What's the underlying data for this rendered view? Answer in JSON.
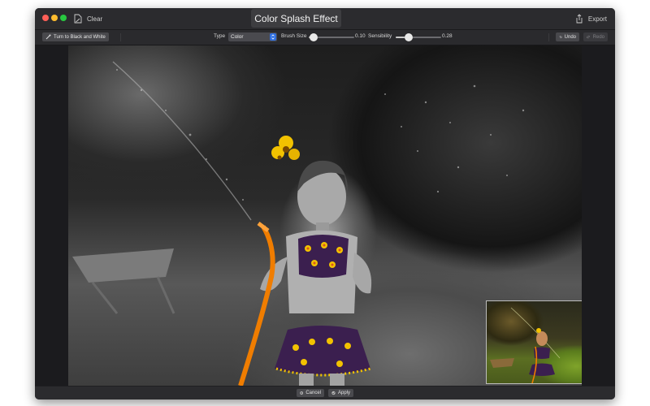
{
  "window": {
    "clear_label": "Clear",
    "title": "Color Splash Effect",
    "export_label": "Export"
  },
  "toolbar": {
    "bw_button": "Turn to Black and White",
    "type_label": "Type",
    "type_value": "Color",
    "brush_label": "Brush Size",
    "brush_value": "0.10",
    "brush_level": 0.1,
    "sensibility_label": "Sensibility",
    "sensibility_value": "0.28",
    "sensibility_level": 0.28,
    "undo_label": "Undo",
    "redo_label": "Redo"
  },
  "footer": {
    "cancel_label": "Cancel",
    "apply_label": "Apply"
  },
  "colors": {
    "accent": "#2f6fe0",
    "flower": "#f2c200",
    "hose": "#f07d00"
  }
}
